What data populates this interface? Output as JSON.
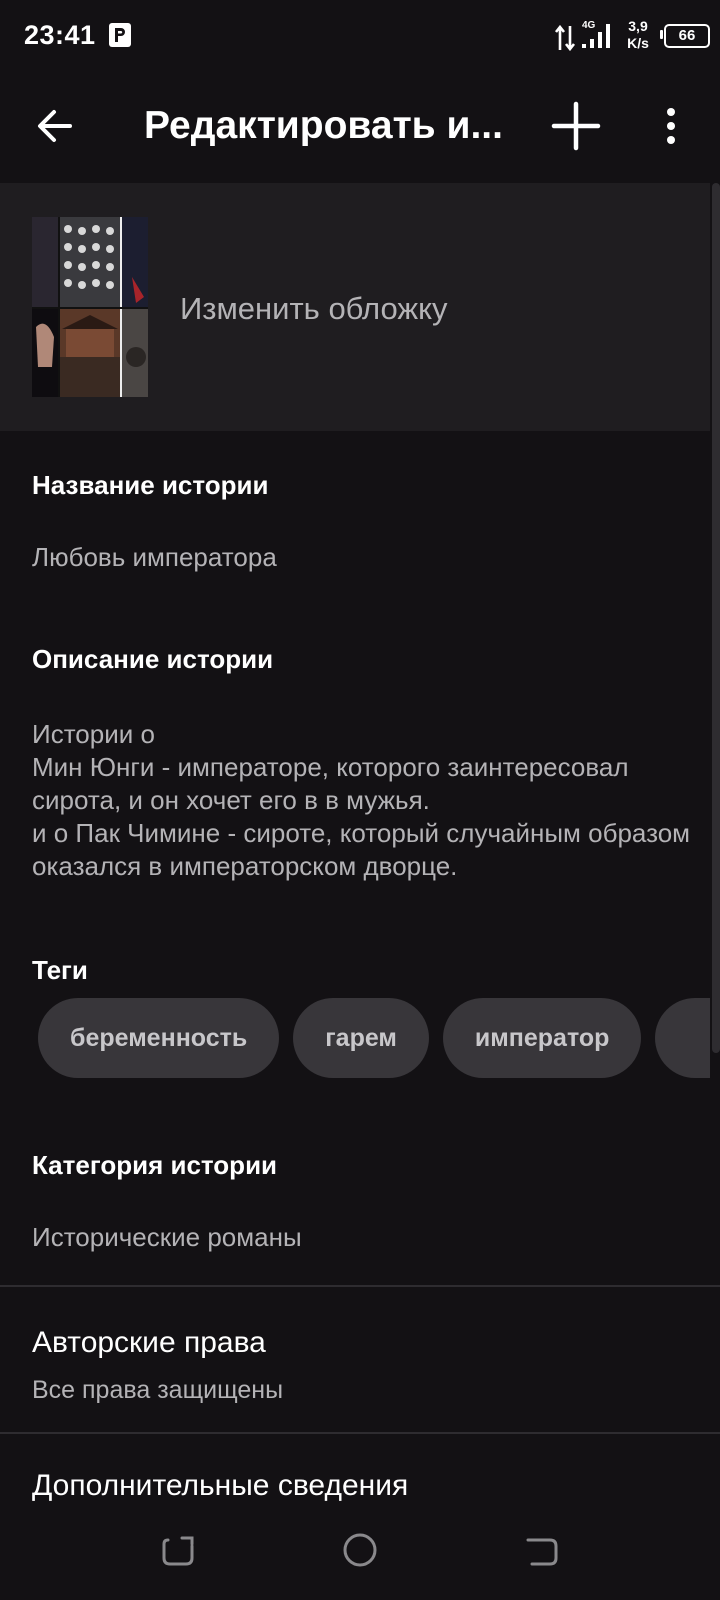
{
  "status_bar": {
    "time": "23:41",
    "network_type": "4G",
    "speed": "3,9\nK/s",
    "battery": "66"
  },
  "app_bar": {
    "title": "Редактировать и...",
    "back_icon": "arrow-left-icon",
    "add_icon": "plus-icon",
    "more_icon": "more-vertical-icon"
  },
  "cover": {
    "label": "Изменить обложку"
  },
  "story": {
    "title_heading": "Название истории",
    "title_value": "Любовь императора",
    "description_heading": "Описание истории",
    "description_value": "Истории о\nМин Юнги - императоре, которого заинтересовал сирота, и он хочет его в в мужья.\nи о Пак Чимине - сироте, который случайным образом оказался в императорском дворце.",
    "tags_heading": "Теги",
    "tags": [
      "беременность",
      "гарем",
      "император",
      ""
    ],
    "category_heading": "Категория истории",
    "category_value": "Исторические романы"
  },
  "copyright": {
    "title": "Авторские права",
    "value": "Все права защищены"
  },
  "additional": {
    "title": "Дополнительные сведения"
  },
  "nav_bar": {
    "recent_icon": "recent-apps-icon",
    "home_icon": "home-icon",
    "back_icon": "back-nav-icon"
  },
  "colors": {
    "background": "#131114",
    "surface": "#1f1d20",
    "chip": "#38363a",
    "text_primary": "#ffffff",
    "text_secondary": "#b4b3b6"
  }
}
